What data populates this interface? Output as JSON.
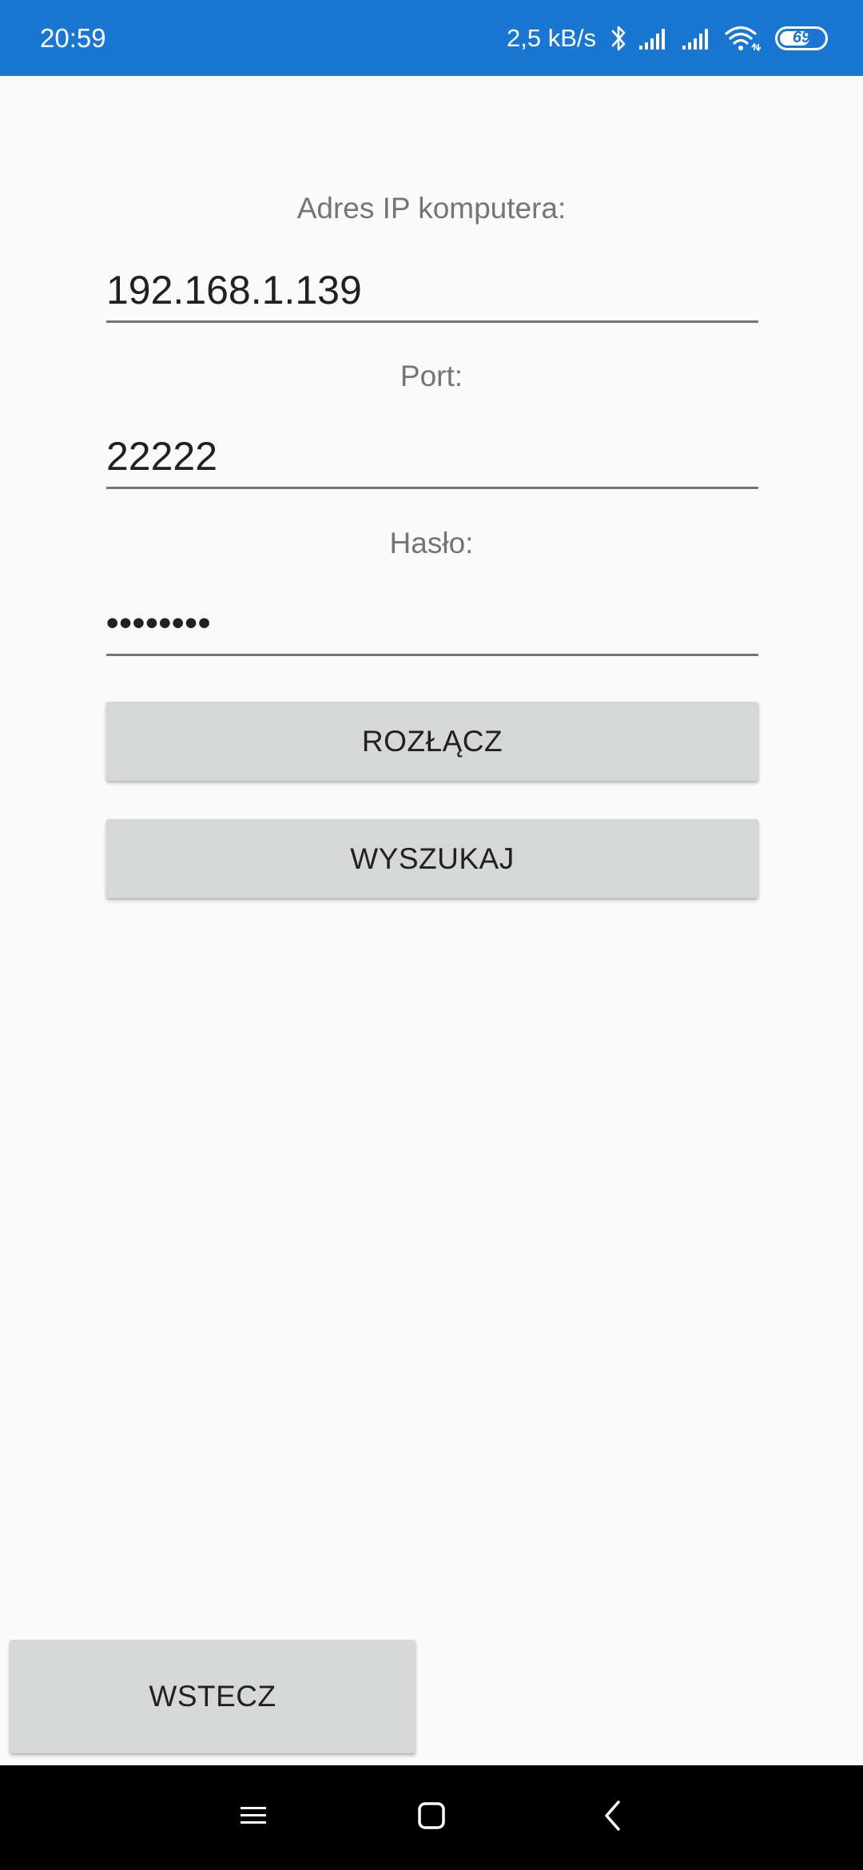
{
  "status_bar": {
    "time": "20:59",
    "net_speed": "2,5 kB/s",
    "battery_level": "69",
    "battery_fraction": 0.69,
    "icons": [
      "bluetooth-icon",
      "signal-icon",
      "signal-icon",
      "wifi-icon",
      "battery-icon"
    ]
  },
  "form": {
    "ip_label": "Adres IP komputera:",
    "ip_value": "192.168.1.139",
    "port_label": "Port:",
    "port_value": "22222",
    "password_label": "Hasło:",
    "password_value": "••••••••"
  },
  "buttons": {
    "disconnect": "ROZŁĄCZ",
    "search": "WYSZUKAJ",
    "back": "WSTECZ"
  },
  "navigation_bar": {
    "icons": [
      "menu-icon",
      "home-icon",
      "back-icon"
    ]
  },
  "colors": {
    "status_bar": "#1976d2",
    "background": "#fafafa",
    "button": "#d6d7d7",
    "nav_bar": "#000000"
  }
}
